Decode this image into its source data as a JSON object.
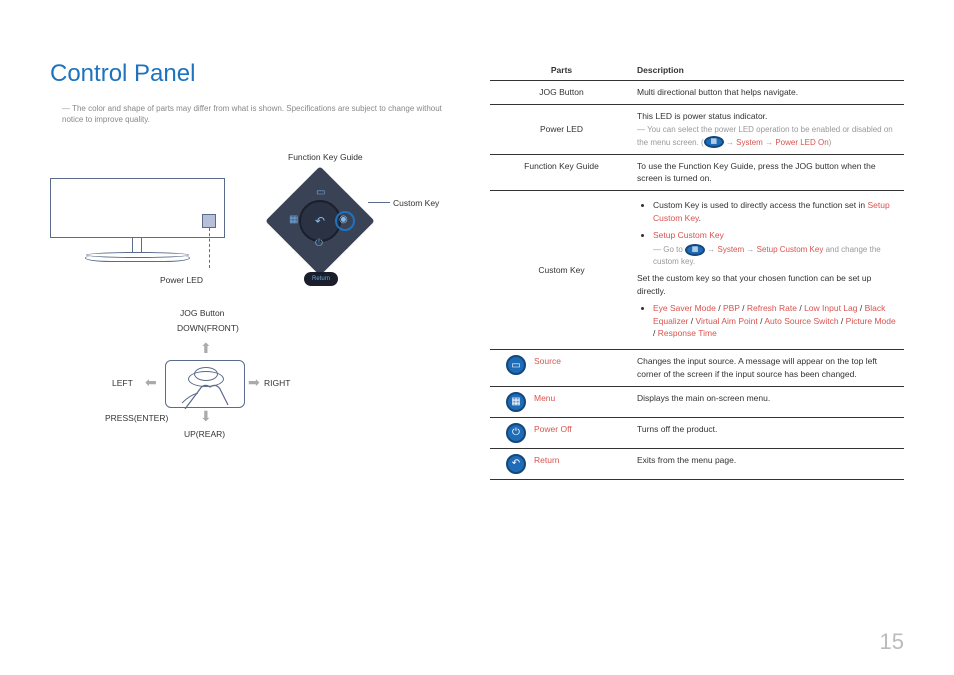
{
  "title": "Control Panel",
  "disclaimer": "The color and shape of parts may differ from what is shown. Specifications are subject to change without notice to improve quality.",
  "diagram_labels": {
    "function_key_guide": "Function Key Guide",
    "custom_key": "Custom Key",
    "return": "Return",
    "power_led": "Power LED",
    "jog_button": "JOG Button",
    "down_front": "DOWN(FRONT)",
    "up_rear": "UP(REAR)",
    "left": "LEFT",
    "right": "RIGHT",
    "press_enter": "PRESS(ENTER)"
  },
  "table": {
    "headers": {
      "parts": "Parts",
      "description": "Description"
    },
    "rows": {
      "jog": {
        "name": "JOG Button",
        "desc": "Multi directional button that helps navigate."
      },
      "power_led": {
        "name": "Power LED",
        "line1": "This LED is power status indicator.",
        "note_pre": "You can select the power LED operation to be enabled or disabled on the menu screen. (",
        "system": "System",
        "pled_on": "Power LED On",
        "note_post": ")"
      },
      "fkg": {
        "name": "Function Key Guide",
        "desc": "To use the Function Key Guide, press the JOG button when the screen is turned on."
      },
      "custom": {
        "name": "Custom Key",
        "b1_pre": "Custom Key is used to directly access the function set in ",
        "b1_link": "Setup Custom Key",
        "b1_post": ".",
        "b2": "Setup Custom Key",
        "note_pre": "Go to ",
        "note_system": "System",
        "note_sck": "Setup Custom Key",
        "note_post": " and change the custom key.",
        "mid": "Set the custom key so that your chosen function can be set up directly.",
        "opts": {
          "o1": "Eye Saver Mode",
          "o2": "PBP",
          "o3": "Refresh Rate",
          "o4": "Low Input Lag",
          "o5": "Black Equalizer",
          "o6": "Virtual Aim Point",
          "o7": "Auto Source Switch",
          "o8": "Picture Mode",
          "o9": "Response Time"
        }
      },
      "source": {
        "name": "Source",
        "desc": "Changes the input source. A message will appear on the top left corner of the screen if the input source has been changed."
      },
      "menu": {
        "name": "Menu",
        "desc": "Displays the main on-screen menu."
      },
      "power_off": {
        "name": "Power Off",
        "desc": "Turns off the product."
      },
      "return": {
        "name": "Return",
        "desc": "Exits from the menu page."
      }
    }
  },
  "page_number": "15"
}
